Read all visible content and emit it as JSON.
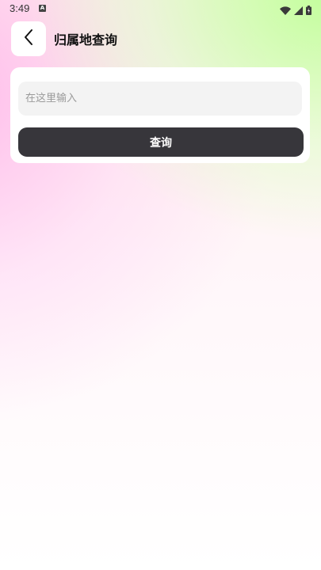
{
  "status_bar": {
    "time": "3:49",
    "notification_badge": "A",
    "icons": [
      "wifi-icon",
      "signal-icon",
      "battery-icon"
    ]
  },
  "header": {
    "back_icon": "chevron-left-icon",
    "title": "归属地查询"
  },
  "form": {
    "input_value": "",
    "input_placeholder": "在这里输入",
    "submit_label": "查询"
  },
  "colors": {
    "button_bg": "#37363b",
    "button_text": "#ffffff",
    "input_bg": "#f3f3f3",
    "placeholder": "#9a9a9a",
    "card_bg": "#ffffff"
  }
}
